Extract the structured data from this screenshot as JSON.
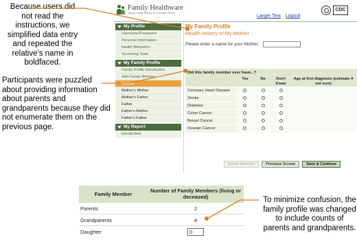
{
  "annotations": {
    "note_top": "Because users did not read the instructions, we simplified data entry and repeated the relative's name in boldfaced.",
    "note_middle": "Participants were puzzled about providing information about parents and grandparents because they did not enumerate them on the previous page.",
    "note_bottom": "To minimize confusion, the family profile was changed to include counts of parents and grandparents."
  },
  "header": {
    "logo_title": "Family Healthware",
    "logo_subtitle": "Using Family History to Promote Health",
    "links": [
      "Larger Text",
      "Logout"
    ],
    "cdc_label": "CDC"
  },
  "sidebar": {
    "sections": [
      {
        "title": "My Profile",
        "items": [
          "Username/Password",
          "Personal Information",
          "Health Behaviors",
          "Screening Tests"
        ]
      },
      {
        "title": "My Family Profile",
        "items": [
          "Family Profile Introduction",
          "Add Family Member",
          "Mother",
          "Mother's Mother",
          "Mother's Father",
          "Father",
          "Father's Mother",
          "Father's Father"
        ],
        "active_item": "Mother"
      },
      {
        "title": "My Report",
        "items": [
          "Introduction"
        ]
      }
    ]
  },
  "main": {
    "title": "My Family Profile",
    "subtitle": "Health History of My Mother",
    "name_prompt": "Please enter a name for your",
    "name_relative": "Mother",
    "name_value": "",
    "question": "Did this family member ever have...?",
    "columns": [
      "Yes",
      "No",
      "Don't Know",
      "Age at first diagnosis (estimate if not sure)"
    ],
    "conditions": [
      "Coronary Heart Disease",
      "Stroke",
      "Diabetes",
      "Colon Cancer",
      "Breast Cancer",
      "Ovarian Cancer"
    ],
    "buttons": {
      "delete": "Delete Member",
      "previous": "Previous Screen",
      "save": "Save & Continue"
    }
  },
  "counts_table": {
    "headers": [
      "Family Member",
      "Number of Family Members (living or deceased)"
    ],
    "rows": [
      {
        "member": "Parents",
        "count": "2"
      },
      {
        "member": "Grandparents",
        "count": "4"
      },
      {
        "member": "Daughter",
        "count": "0"
      }
    ]
  },
  "colors": {
    "accent_orange": "#e07a1a",
    "sidebar_green": "#4d6b3c",
    "active_item": "#e9a23b",
    "arrow": "#e07a1a"
  }
}
